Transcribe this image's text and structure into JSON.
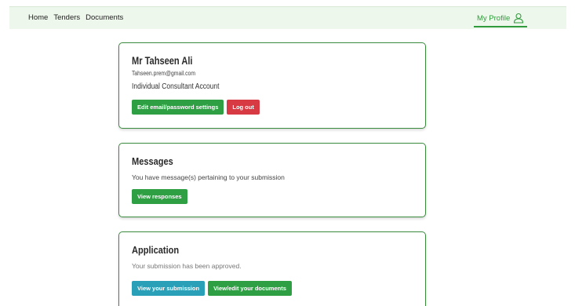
{
  "nav": {
    "links": [
      "Home",
      "Tenders",
      "Documents"
    ],
    "profile_label": "My Profile"
  },
  "profile": {
    "name": "Mr Tahseen Ali",
    "email": "Tahseen.prem@gmail.com",
    "account_type": "Individual Consultant Account",
    "edit_label": "Edit email/password settings",
    "logout_label": "Log out"
  },
  "messages": {
    "title": "Messages",
    "text": "You have message(s) pertaining to your submission",
    "button_label": "View responses"
  },
  "application": {
    "title": "Application",
    "text": "Your submission has been approved.",
    "view_submission_label": "View your submission",
    "view_documents_label": "View/edit your documents"
  },
  "colors": {
    "accent_green": "#2ea043",
    "danger_red": "#d83a44",
    "info_teal": "#2a9fb8",
    "card_border": "#3b8b3f",
    "nav_background": "#eef7ec"
  }
}
